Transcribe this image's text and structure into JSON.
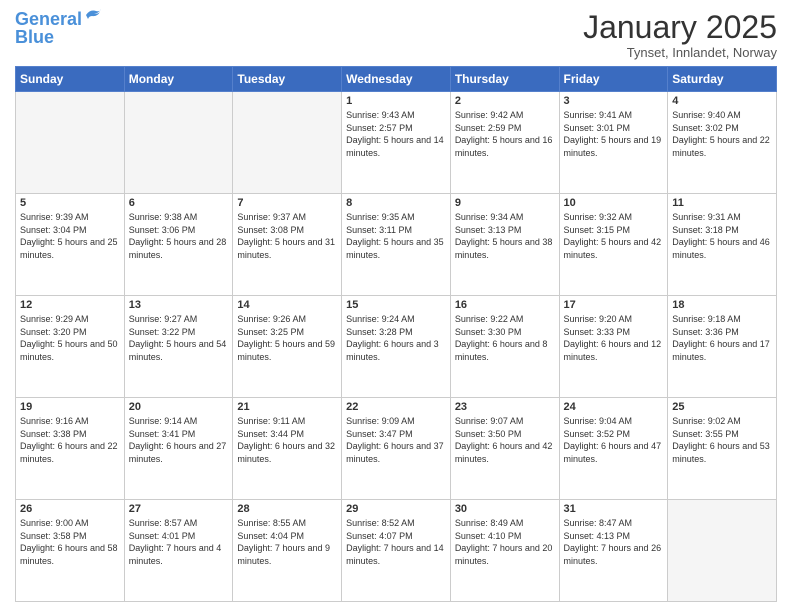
{
  "logo": {
    "line1": "General",
    "line2": "Blue"
  },
  "title": "January 2025",
  "subtitle": "Tynset, Innlandet, Norway",
  "days_header": [
    "Sunday",
    "Monday",
    "Tuesday",
    "Wednesday",
    "Thursday",
    "Friday",
    "Saturday"
  ],
  "weeks": [
    [
      {
        "num": "",
        "info": ""
      },
      {
        "num": "",
        "info": ""
      },
      {
        "num": "",
        "info": ""
      },
      {
        "num": "1",
        "info": "Sunrise: 9:43 AM\nSunset: 2:57 PM\nDaylight: 5 hours\nand 14 minutes."
      },
      {
        "num": "2",
        "info": "Sunrise: 9:42 AM\nSunset: 2:59 PM\nDaylight: 5 hours\nand 16 minutes."
      },
      {
        "num": "3",
        "info": "Sunrise: 9:41 AM\nSunset: 3:01 PM\nDaylight: 5 hours\nand 19 minutes."
      },
      {
        "num": "4",
        "info": "Sunrise: 9:40 AM\nSunset: 3:02 PM\nDaylight: 5 hours\nand 22 minutes."
      }
    ],
    [
      {
        "num": "5",
        "info": "Sunrise: 9:39 AM\nSunset: 3:04 PM\nDaylight: 5 hours\nand 25 minutes."
      },
      {
        "num": "6",
        "info": "Sunrise: 9:38 AM\nSunset: 3:06 PM\nDaylight: 5 hours\nand 28 minutes."
      },
      {
        "num": "7",
        "info": "Sunrise: 9:37 AM\nSunset: 3:08 PM\nDaylight: 5 hours\nand 31 minutes."
      },
      {
        "num": "8",
        "info": "Sunrise: 9:35 AM\nSunset: 3:11 PM\nDaylight: 5 hours\nand 35 minutes."
      },
      {
        "num": "9",
        "info": "Sunrise: 9:34 AM\nSunset: 3:13 PM\nDaylight: 5 hours\nand 38 minutes."
      },
      {
        "num": "10",
        "info": "Sunrise: 9:32 AM\nSunset: 3:15 PM\nDaylight: 5 hours\nand 42 minutes."
      },
      {
        "num": "11",
        "info": "Sunrise: 9:31 AM\nSunset: 3:18 PM\nDaylight: 5 hours\nand 46 minutes."
      }
    ],
    [
      {
        "num": "12",
        "info": "Sunrise: 9:29 AM\nSunset: 3:20 PM\nDaylight: 5 hours\nand 50 minutes."
      },
      {
        "num": "13",
        "info": "Sunrise: 9:27 AM\nSunset: 3:22 PM\nDaylight: 5 hours\nand 54 minutes."
      },
      {
        "num": "14",
        "info": "Sunrise: 9:26 AM\nSunset: 3:25 PM\nDaylight: 5 hours\nand 59 minutes."
      },
      {
        "num": "15",
        "info": "Sunrise: 9:24 AM\nSunset: 3:28 PM\nDaylight: 6 hours\nand 3 minutes."
      },
      {
        "num": "16",
        "info": "Sunrise: 9:22 AM\nSunset: 3:30 PM\nDaylight: 6 hours\nand 8 minutes."
      },
      {
        "num": "17",
        "info": "Sunrise: 9:20 AM\nSunset: 3:33 PM\nDaylight: 6 hours\nand 12 minutes."
      },
      {
        "num": "18",
        "info": "Sunrise: 9:18 AM\nSunset: 3:36 PM\nDaylight: 6 hours\nand 17 minutes."
      }
    ],
    [
      {
        "num": "19",
        "info": "Sunrise: 9:16 AM\nSunset: 3:38 PM\nDaylight: 6 hours\nand 22 minutes."
      },
      {
        "num": "20",
        "info": "Sunrise: 9:14 AM\nSunset: 3:41 PM\nDaylight: 6 hours\nand 27 minutes."
      },
      {
        "num": "21",
        "info": "Sunrise: 9:11 AM\nSunset: 3:44 PM\nDaylight: 6 hours\nand 32 minutes."
      },
      {
        "num": "22",
        "info": "Sunrise: 9:09 AM\nSunset: 3:47 PM\nDaylight: 6 hours\nand 37 minutes."
      },
      {
        "num": "23",
        "info": "Sunrise: 9:07 AM\nSunset: 3:50 PM\nDaylight: 6 hours\nand 42 minutes."
      },
      {
        "num": "24",
        "info": "Sunrise: 9:04 AM\nSunset: 3:52 PM\nDaylight: 6 hours\nand 47 minutes."
      },
      {
        "num": "25",
        "info": "Sunrise: 9:02 AM\nSunset: 3:55 PM\nDaylight: 6 hours\nand 53 minutes."
      }
    ],
    [
      {
        "num": "26",
        "info": "Sunrise: 9:00 AM\nSunset: 3:58 PM\nDaylight: 6 hours\nand 58 minutes."
      },
      {
        "num": "27",
        "info": "Sunrise: 8:57 AM\nSunset: 4:01 PM\nDaylight: 7 hours\nand 4 minutes."
      },
      {
        "num": "28",
        "info": "Sunrise: 8:55 AM\nSunset: 4:04 PM\nDaylight: 7 hours\nand 9 minutes."
      },
      {
        "num": "29",
        "info": "Sunrise: 8:52 AM\nSunset: 4:07 PM\nDaylight: 7 hours\nand 14 minutes."
      },
      {
        "num": "30",
        "info": "Sunrise: 8:49 AM\nSunset: 4:10 PM\nDaylight: 7 hours\nand 20 minutes."
      },
      {
        "num": "31",
        "info": "Sunrise: 8:47 AM\nSunset: 4:13 PM\nDaylight: 7 hours\nand 26 minutes."
      },
      {
        "num": "",
        "info": ""
      }
    ]
  ]
}
